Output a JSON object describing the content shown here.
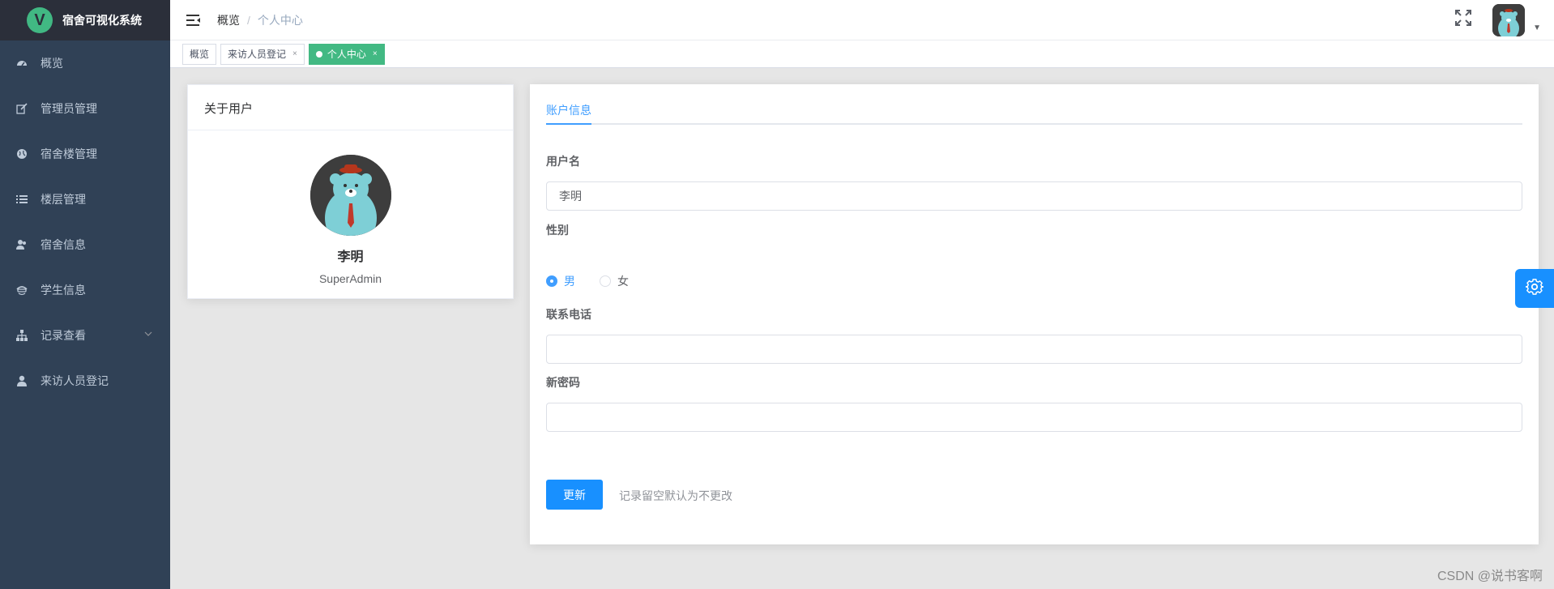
{
  "app": {
    "title": "宿舍可视化系统",
    "logo_letter": "V"
  },
  "sidebar": {
    "items": [
      {
        "label": "概览",
        "icon": "dashboard-icon"
      },
      {
        "label": "管理员管理",
        "icon": "edit-icon"
      },
      {
        "label": "宿舍楼管理",
        "icon": "globe-icon"
      },
      {
        "label": "楼层管理",
        "icon": "list-icon"
      },
      {
        "label": "宿舍信息",
        "icon": "users-icon"
      },
      {
        "label": "学生信息",
        "icon": "student-icon"
      },
      {
        "label": "记录查看",
        "icon": "sitemap-icon",
        "has_children": true
      },
      {
        "label": "来访人员登记",
        "icon": "user-icon"
      }
    ]
  },
  "header": {
    "breadcrumb": [
      "概览",
      "个人中心"
    ],
    "separator": "/"
  },
  "tags": [
    {
      "label": "概览",
      "closable": false,
      "active": false
    },
    {
      "label": "来访人员登记",
      "closable": true,
      "active": false
    },
    {
      "label": "个人中心",
      "closable": true,
      "active": true
    }
  ],
  "user_card": {
    "title": "关于用户",
    "name": "李明",
    "role": "SuperAdmin"
  },
  "form": {
    "tab": "账户信息",
    "username_label": "用户名",
    "username_value": "李明",
    "gender_label": "性别",
    "gender_options": [
      {
        "label": "男",
        "checked": true
      },
      {
        "label": "女",
        "checked": false
      }
    ],
    "phone_label": "联系电话",
    "phone_value": "",
    "password_label": "新密码",
    "password_value": "",
    "submit_label": "更新",
    "hint": "记录留空默认为不更改"
  },
  "watermark": "CSDN @说书客啊",
  "colors": {
    "sidebar_bg": "#304156",
    "accent": "#1890ff",
    "tag_active": "#42b983"
  }
}
